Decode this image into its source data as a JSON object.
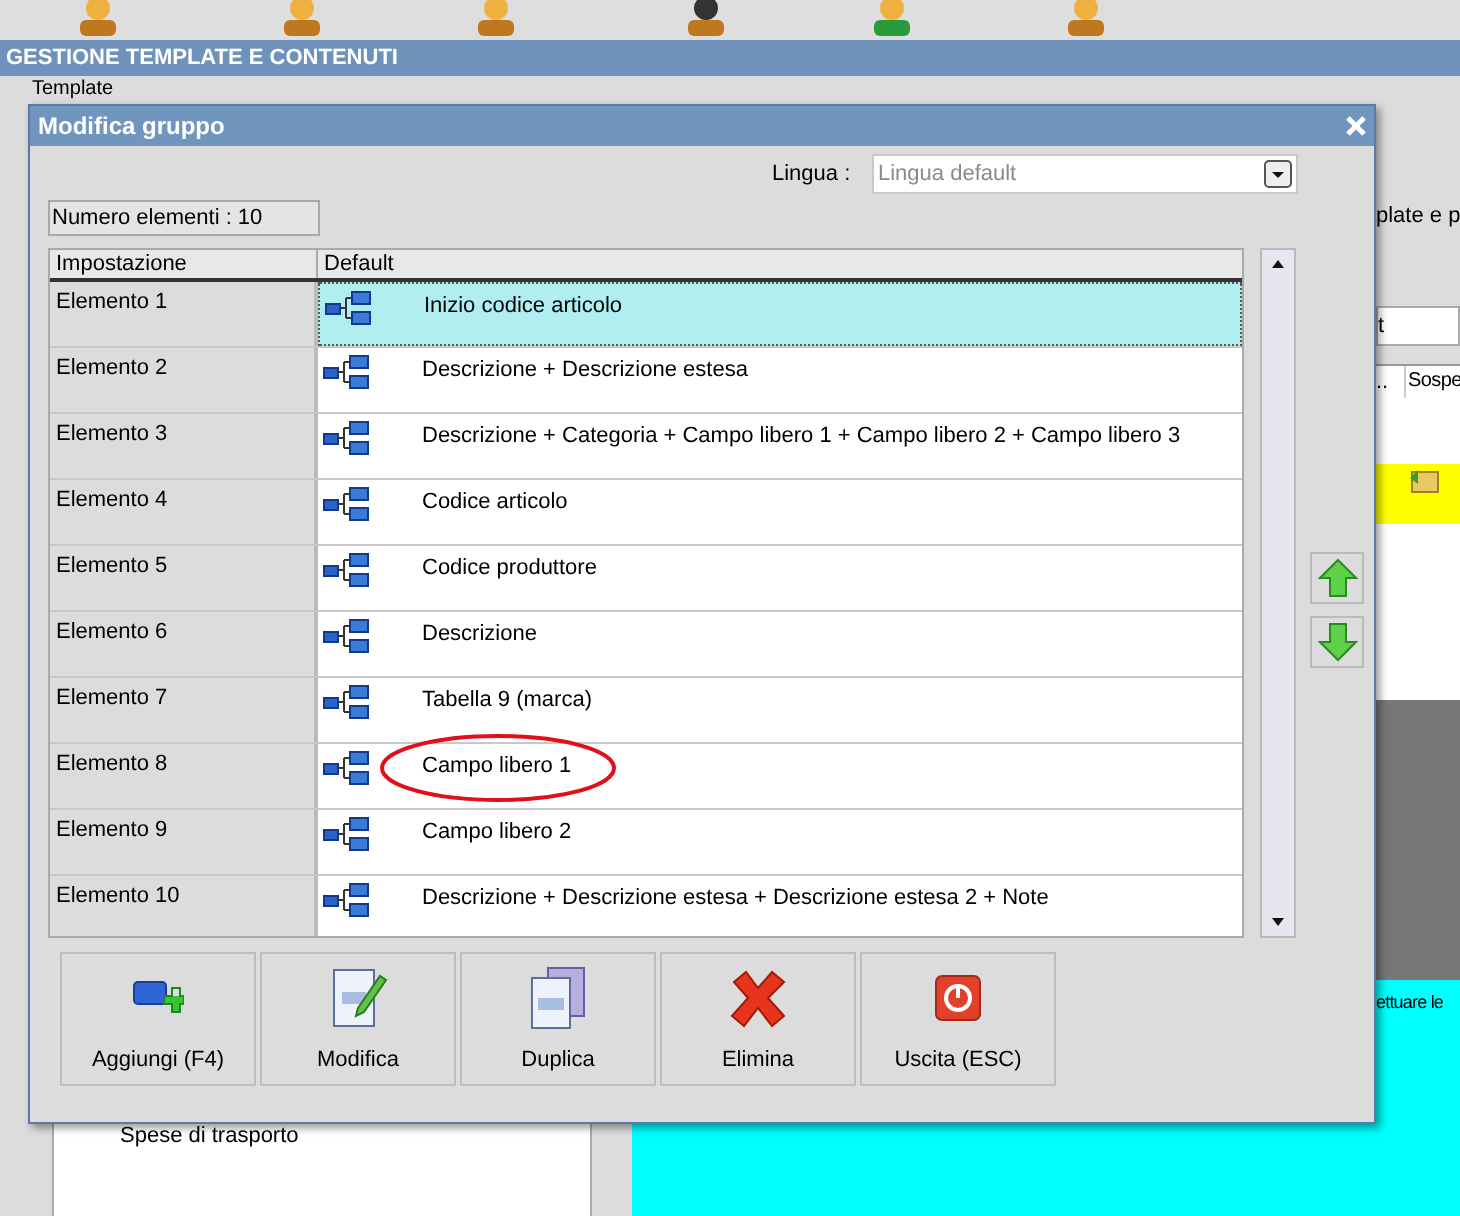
{
  "background": {
    "title": "GESTIONE TEMPLATE E CONTENUTI",
    "template_label": "Template",
    "side_text": "plate e p",
    "filter_text": "t",
    "columns": [
      "..",
      "Sospe"
    ],
    "message": "ettuare le",
    "tree_item": "Spese di trasporto"
  },
  "dialog": {
    "title": "Modifica gruppo",
    "language": {
      "label": "Lingua :",
      "value": "Lingua default"
    },
    "count": "Numero elementi : 10",
    "columns": [
      "Impostazione",
      "Default"
    ],
    "rows": [
      {
        "name": "Elemento 1",
        "value": "Inizio codice articolo",
        "selected": true,
        "circled": false
      },
      {
        "name": "Elemento 2",
        "value": "Descrizione + Descrizione estesa",
        "selected": false,
        "circled": false
      },
      {
        "name": "Elemento 3",
        "value": "Descrizione + Categoria + Campo libero 1 + Campo libero 2 + Campo libero 3",
        "selected": false,
        "circled": false
      },
      {
        "name": "Elemento 4",
        "value": "Codice articolo",
        "selected": false,
        "circled": false
      },
      {
        "name": "Elemento 5",
        "value": "Codice produttore",
        "selected": false,
        "circled": false
      },
      {
        "name": "Elemento 6",
        "value": "Descrizione",
        "selected": false,
        "circled": false
      },
      {
        "name": "Elemento 7",
        "value": "Tabella 9 (marca)",
        "selected": false,
        "circled": false
      },
      {
        "name": "Elemento 8",
        "value": "Campo libero 1",
        "selected": false,
        "circled": true
      },
      {
        "name": "Elemento 9",
        "value": "Campo libero 2",
        "selected": false,
        "circled": false
      },
      {
        "name": "Elemento 10",
        "value": "Descrizione + Descrizione estesa + Descrizione estesa 2 + Note",
        "selected": false,
        "circled": false
      }
    ],
    "buttons": [
      {
        "label": "Aggiungi (F4)",
        "kind": "add"
      },
      {
        "label": "Modifica",
        "kind": "edit"
      },
      {
        "label": "Duplica",
        "kind": "duplicate"
      },
      {
        "label": "Elimina",
        "kind": "delete"
      },
      {
        "label": "Uscita (ESC)",
        "kind": "exit"
      }
    ]
  }
}
